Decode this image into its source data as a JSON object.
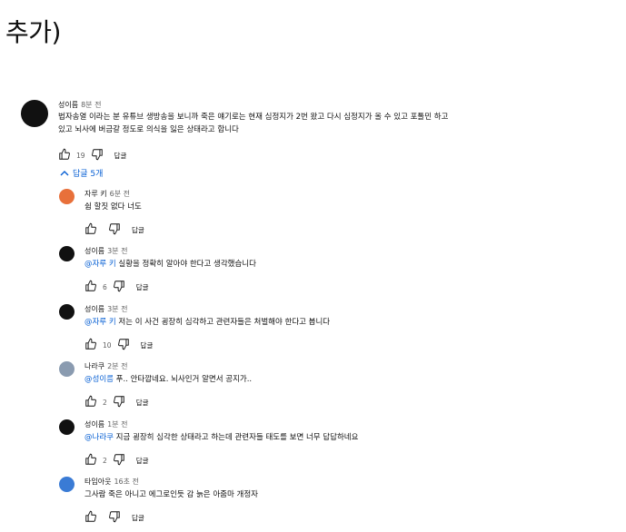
{
  "heading": "추가)",
  "main_comment": {
    "author": "성이름",
    "time": "8분 전",
    "text_line1": "법자송열 이라는 분 유튜브 생방송을 보니까 죽은 얘기로는 현재 심정지가 2번 왔고 다시 심정지가 올 수 있고 포톨민 하고",
    "text_line2": "있고 뇌사에 버금갈 정도로 의식을 잃은 상태라고 합니다",
    "likes": "19",
    "reply_label": "답글"
  },
  "replies_toggle": "답글 5개",
  "replies": [
    {
      "author": "자루 키",
      "time": "6분 전",
      "mention": "",
      "text": "쉼 할짓 없다 너도",
      "likes": "",
      "reply_label": "답글",
      "avatar_color": "#e8703a"
    },
    {
      "author": "성이름",
      "time": "3분 전",
      "mention": "@자루 키",
      "text": " 실황을 정확히 알아야 한다고 생각했습니다",
      "likes": "6",
      "reply_label": "답글",
      "avatar_color": "#111111"
    },
    {
      "author": "성이름",
      "time": "3분 전",
      "mention": "@자루 키",
      "text": " 저는 이 사건 굉장히 심각하고 관련자들은 처벌해야 한다고 봅니다",
      "likes": "10",
      "reply_label": "답글",
      "avatar_color": "#111111"
    },
    {
      "author": "나라쿠",
      "time": "2분 전",
      "mention": "@성이름",
      "text": " 푸.. 안타깝네요. 뇌사인거 알면서 공지가..",
      "likes": "2",
      "reply_label": "답글",
      "avatar_color": "#8a9bb0"
    },
    {
      "author": "성이름",
      "time": "1분 전",
      "mention": "@나라쿠",
      "text": " 지금 굉장히 심각한 상태라고 하는데 관련자들 태도를 보면 너무 답답하네요",
      "likes": "2",
      "reply_label": "답글",
      "avatar_color": "#111111"
    },
    {
      "author": "타임아웃",
      "time": "16초 전",
      "mention": "",
      "text": "그사람 죽은 아니고 에그로인듯 감 늙은 아줌마 개정자",
      "likes": "",
      "reply_label": "답글",
      "avatar_color": "#3a7bd5"
    }
  ]
}
